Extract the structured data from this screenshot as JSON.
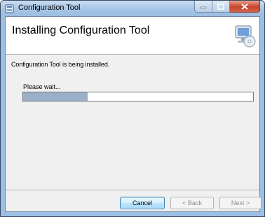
{
  "window": {
    "title": "Configuration Tool"
  },
  "banner": {
    "heading": "Installing Configuration Tool"
  },
  "content": {
    "status_text": "Configuration Tool is being installed.",
    "wait_text": "Please wait...",
    "progress_fraction": 0.28
  },
  "buttons": {
    "cancel": "Cancel",
    "back": "< Back",
    "next": "Next >"
  },
  "icons": {
    "app": "installer-icon",
    "banner": "computer-disc-icon",
    "minimize": "minimize-icon",
    "maximize": "maximize-icon",
    "close": "close-icon"
  }
}
